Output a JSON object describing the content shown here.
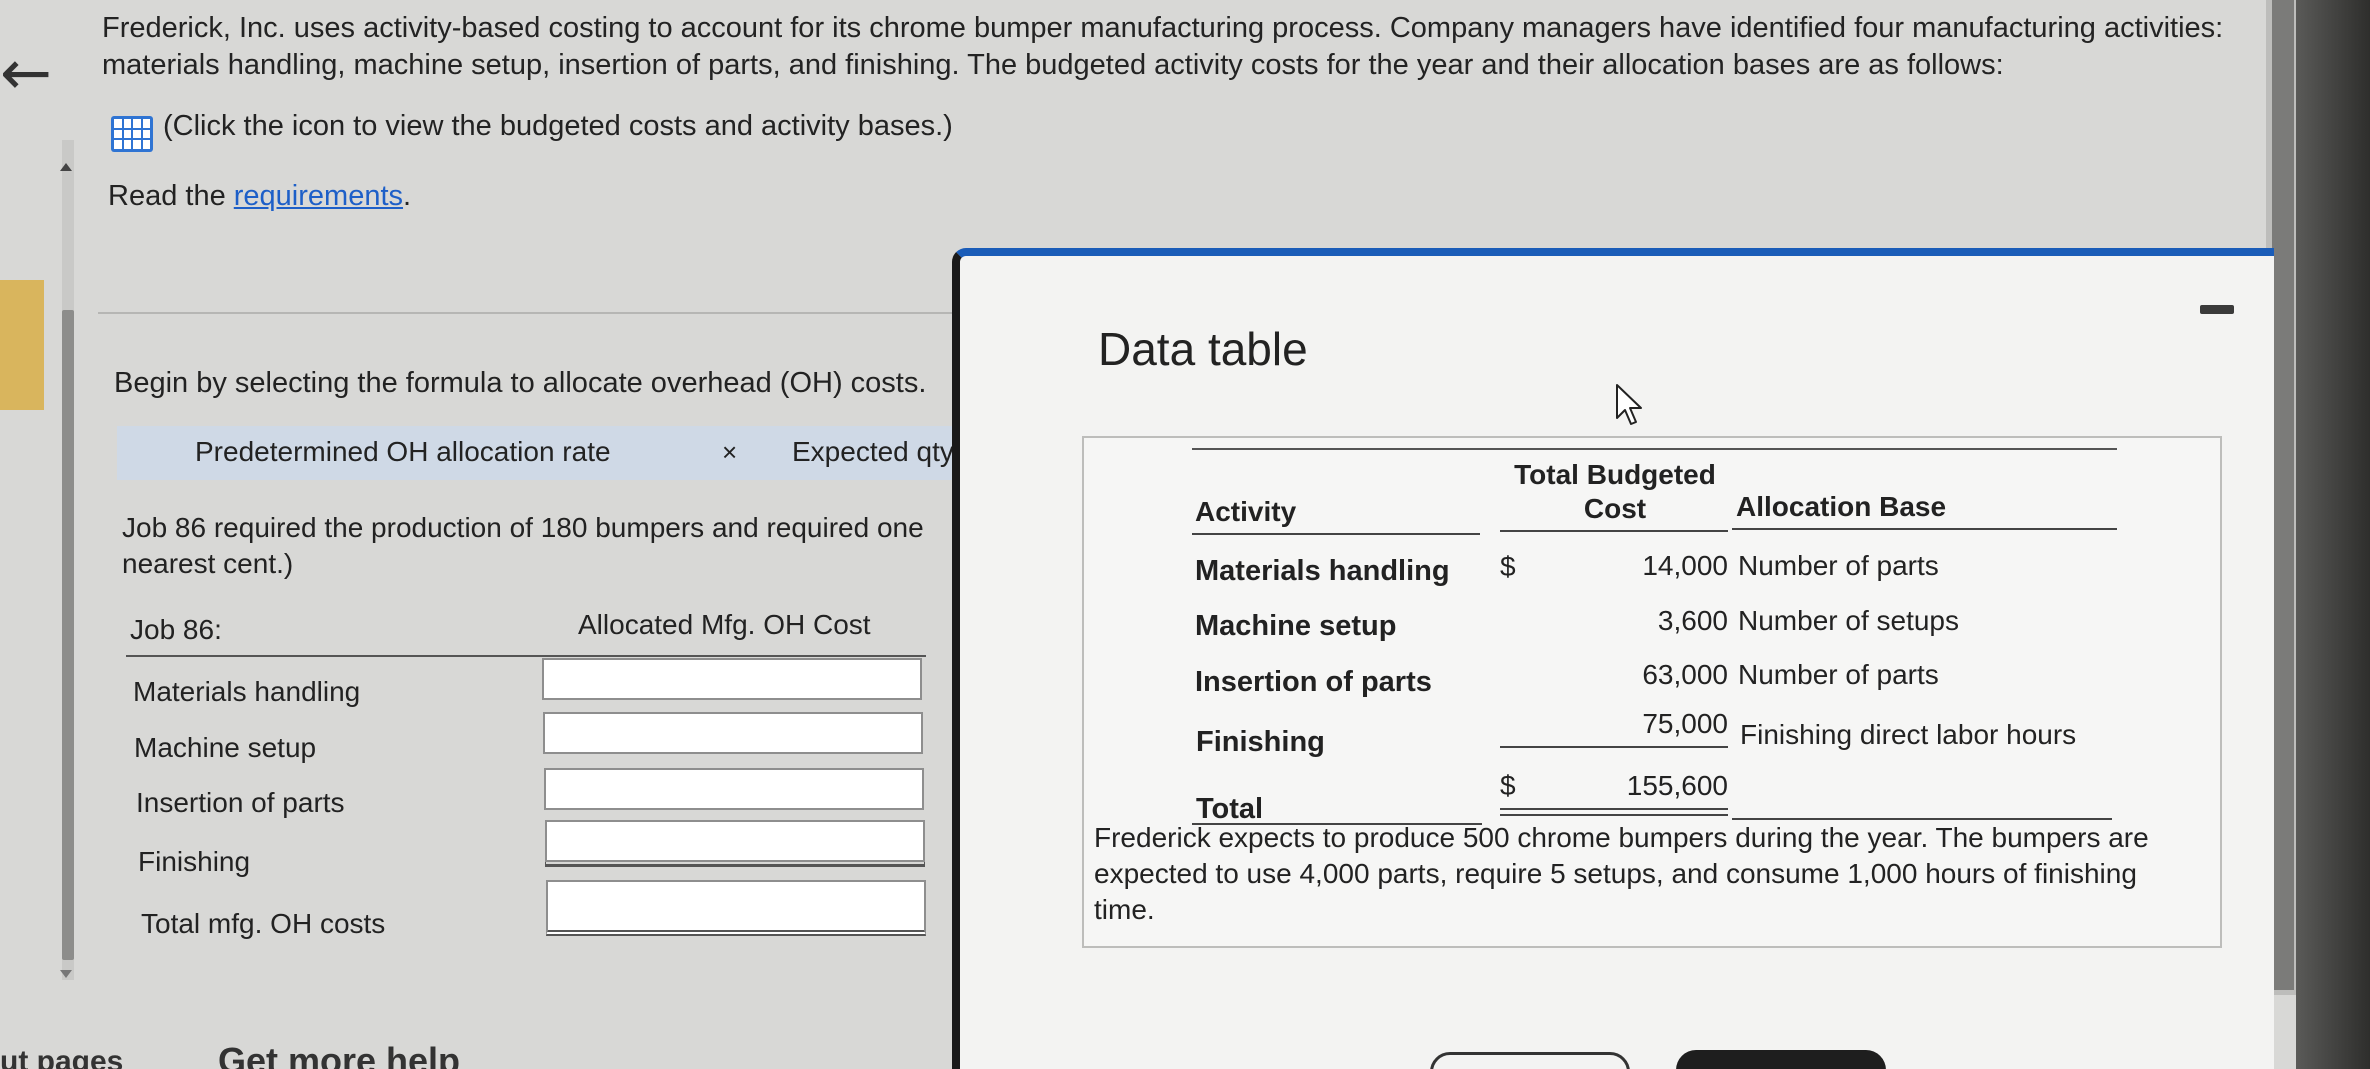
{
  "question": {
    "problem_text": "Frederick, Inc. uses activity-based costing to account for its chrome bumper manufacturing process. Company managers have identified four manufacturing activities: materials handling, machine setup, insertion of parts, and finishing. The budgeted activity costs for the year and their allocation bases are as follows:",
    "click_icon_text": "(Click the icon to view the budgeted costs and activity bases.)",
    "read_prefix": "Read the ",
    "requirements_link": "requirements",
    "read_suffix": "."
  },
  "formula": {
    "prompt": "Begin by selecting the formula to allocate overhead (OH) costs.",
    "left_term": "Predetermined OH allocation rate",
    "operator": "×",
    "right_term": "Expected qty"
  },
  "job": {
    "text_line1": "Job 86 required the production of 180 bumpers and required one",
    "text_line2": "nearest cent.)",
    "header_label": "Job 86:",
    "header_col": "Allocated Mfg. OH Cost",
    "rows": [
      {
        "label": "Materials handling",
        "value": ""
      },
      {
        "label": "Machine setup",
        "value": ""
      },
      {
        "label": "Insertion of parts",
        "value": ""
      },
      {
        "label": "Finishing",
        "value": ""
      },
      {
        "label": "Total mfg. OH costs",
        "value": ""
      }
    ]
  },
  "footer": {
    "next_text": "ut pages",
    "help_text": "Get more help"
  },
  "modal": {
    "title": "Data table",
    "headers": {
      "activity": "Activity",
      "cost_line1": "Total Budgeted",
      "cost_line2": "Cost",
      "base": "Allocation Base"
    },
    "rows": [
      {
        "activity": "Materials handling",
        "dollar": "$",
        "cost": "14,000",
        "base": "Number of parts"
      },
      {
        "activity": "Machine setup",
        "dollar": "",
        "cost": "3,600",
        "base": "Number of setups"
      },
      {
        "activity": "Insertion of parts",
        "dollar": "",
        "cost": "63,000",
        "base": "Number of parts"
      },
      {
        "activity": "Finishing",
        "dollar": "",
        "cost": "75,000",
        "base": "Finishing direct labor hours"
      }
    ],
    "total_label": "Total",
    "total_dollar": "$",
    "total_cost": "155,600",
    "note": "Frederick expects to produce 500 chrome bumpers during the year. The bumpers are expected to use 4,000 parts, require 5 setups, and consume 1,000 hours of finishing time."
  }
}
